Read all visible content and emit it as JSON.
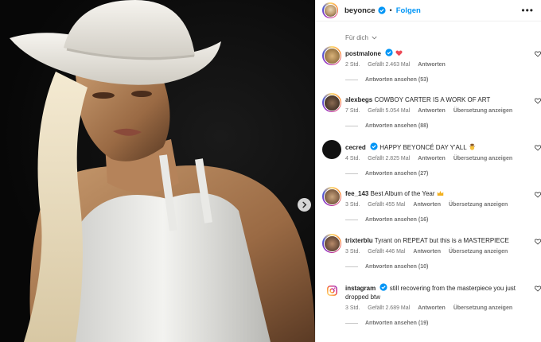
{
  "post": {
    "username": "beyonce",
    "follow_label": "Folgen",
    "separator": "•",
    "more_label": "•••"
  },
  "sort": {
    "label": "Für dich"
  },
  "comments": [
    {
      "username": "postmalone",
      "verified": true,
      "text": "",
      "emoji": "heart",
      "age": "2 Std.",
      "likes": "Gefällt 2.463 Mal",
      "reply": "Antworten",
      "translate": "",
      "replies": "Antworten ansehen (53)"
    },
    {
      "username": "alexbegs",
      "verified": false,
      "text": "COWBOY CARTER IS A WORK OF ART",
      "age": "7 Std.",
      "likes": "Gefällt 5.054 Mal",
      "reply": "Antworten",
      "translate": "Übersetzung anzeigen",
      "replies": "Antworten ansehen (88)"
    },
    {
      "username": "cecred",
      "verified": true,
      "text": "HAPPY BEYONCÉ DAY Y'ALL",
      "emoji": "cowboy",
      "age": "4 Std.",
      "likes": "Gefällt 2.825 Mal",
      "reply": "Antworten",
      "translate": "Übersetzung anzeigen",
      "replies": "Antworten ansehen (27)"
    },
    {
      "username": "fee_143",
      "verified": false,
      "text": "Best Album of the Year",
      "emoji": "crown",
      "age": "3 Std.",
      "likes": "Gefällt 455 Mal",
      "reply": "Antworten",
      "translate": "Übersetzung anzeigen",
      "replies": "Antworten ansehen (16)"
    },
    {
      "username": "trixterblu",
      "verified": false,
      "text": "Tyrant on REPEAT but this is a MASTERPIECE",
      "age": "3 Std.",
      "likes": "Gefällt 446 Mal",
      "reply": "Antworten",
      "translate": "Übersetzung anzeigen",
      "replies": "Antworten ansehen (10)"
    },
    {
      "username": "instagram",
      "verified": true,
      "text": "still recovering from the masterpiece you just dropped btw",
      "age": "3 Std.",
      "likes": "Gefällt 2.689 Mal",
      "reply": "Antworten",
      "translate": "Übersetzung anzeigen",
      "replies": "Antworten ansehen (19)"
    }
  ],
  "colors": {
    "accent": "#0095f6",
    "verified": "#0095f6",
    "heart_red": "#ed4956"
  }
}
